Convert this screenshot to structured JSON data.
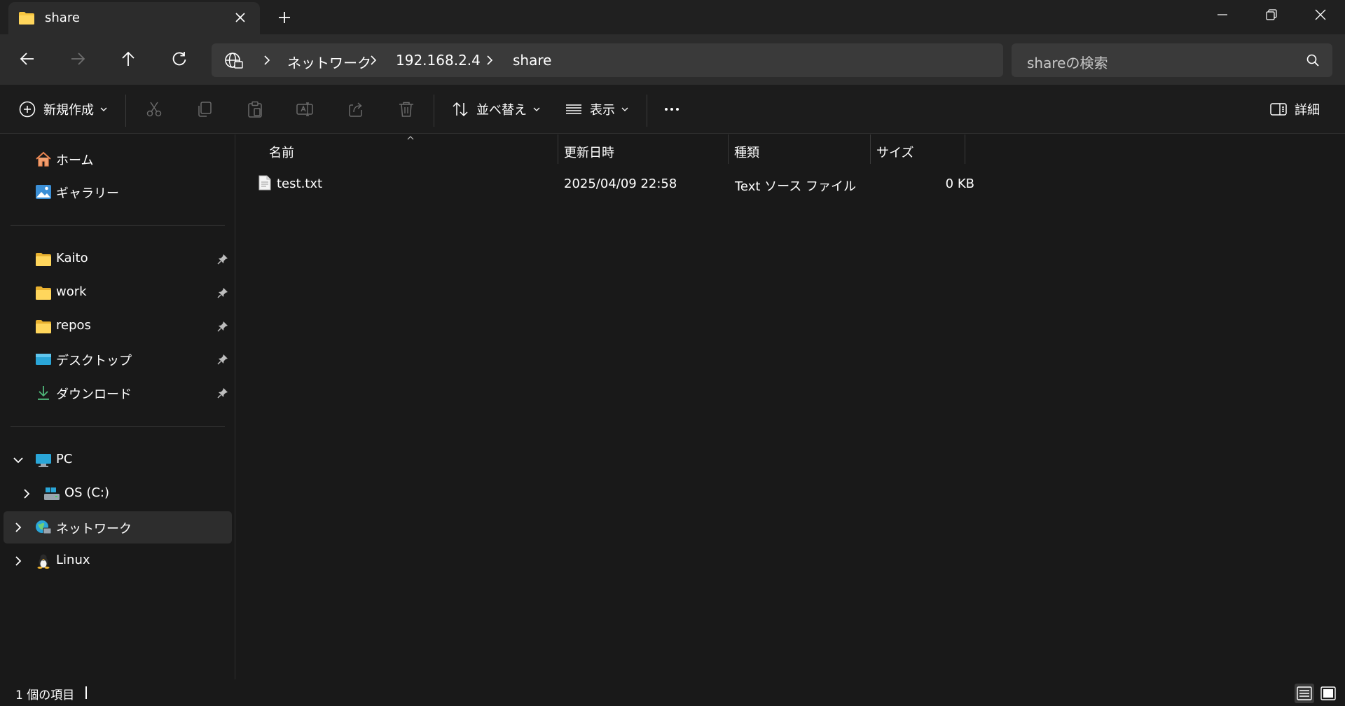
{
  "window": {
    "tab_title": "share",
    "new_tab_icon": "plus-icon",
    "controls": [
      "minimize-icon",
      "restore-icon",
      "close-icon"
    ]
  },
  "address_bar": {
    "breadcrumb": [
      "ネットワーク",
      "192.168.2.4",
      "share"
    ],
    "root_icon": "network-globe-icon"
  },
  "search": {
    "placeholder": "shareの検索"
  },
  "command_bar": {
    "new_label": "新規作成",
    "sort_label": "並べ替え",
    "view_label": "表示",
    "details_label": "詳細",
    "disabled_icons": [
      "cut-icon",
      "copy-icon",
      "paste-icon",
      "rename-icon",
      "share-icon",
      "delete-icon"
    ]
  },
  "sidebar": {
    "quick": [
      {
        "label": "ホーム",
        "icon": "home-icon"
      },
      {
        "label": "ギャラリー",
        "icon": "gallery-icon"
      }
    ],
    "pinned": [
      {
        "label": "Kaito",
        "icon": "folder-icon"
      },
      {
        "label": "work",
        "icon": "folder-icon"
      },
      {
        "label": "repos",
        "icon": "folder-icon"
      },
      {
        "label": "デスクトップ",
        "icon": "desktop-icon"
      },
      {
        "label": "ダウンロード",
        "icon": "download-icon"
      }
    ],
    "tree": [
      {
        "label": "PC",
        "icon": "pc-icon",
        "expanded": true
      },
      {
        "label": "OS (C:)",
        "icon": "drive-icon",
        "expanded": false
      },
      {
        "label": "ネットワーク",
        "icon": "network-icon",
        "expanded": false,
        "selected": true
      },
      {
        "label": "Linux",
        "icon": "linux-icon",
        "expanded": false
      }
    ]
  },
  "file_list": {
    "columns": [
      "名前",
      "更新日時",
      "種類",
      "サイズ"
    ],
    "rows": [
      {
        "name": "test.txt",
        "modified": "2025/04/09 22:58",
        "type": "Text ソース ファイル",
        "size": "0 KB",
        "icon": "text-file-icon"
      }
    ]
  },
  "status_bar": {
    "item_count": "1 個の項目"
  },
  "colors": {
    "background": "#191919",
    "titlebar": "#202020",
    "navbar": "#2c2c2c",
    "field": "#3a3a3a",
    "selected": "#2d2d2d",
    "folder": "#f8c640",
    "text": "#ffffff"
  }
}
